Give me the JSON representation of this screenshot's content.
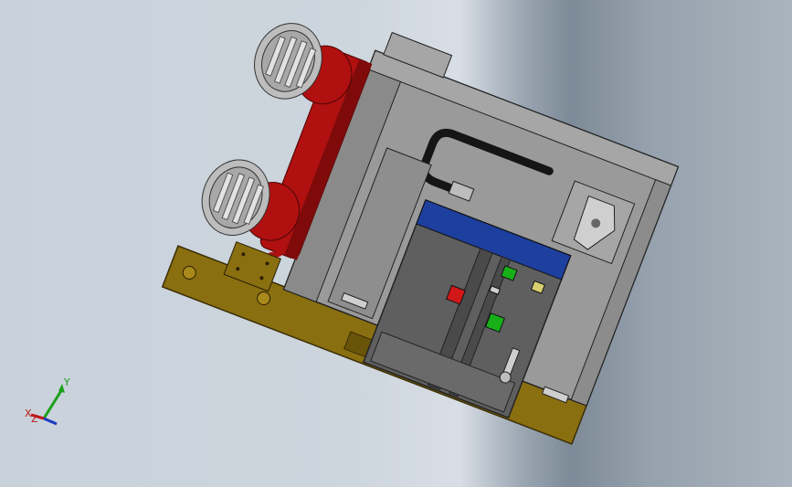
{
  "viewport": {
    "background_top": "#c9d2db",
    "background_band": "#7d8a97"
  },
  "model": {
    "colors": {
      "cabinet": "#9a9a9a",
      "cabinet_dark": "#7c7c7c",
      "insulator": "#b01010",
      "insulator_dark": "#7e0a0a",
      "base": "#8a6f10",
      "base_dark": "#6a540a",
      "blue_band": "#1d3f9e",
      "panel": "#5f5f5f",
      "panel_dark": "#4a4a4a",
      "indicator_red": "#d01818",
      "indicator_green": "#18b018",
      "indicator_yellow": "#d8d070",
      "handle": "#151515",
      "contact": "#bdbdbd"
    }
  },
  "triad": {
    "y_label": "Y",
    "x_label": "X",
    "z_label": "Z",
    "y_color": "#1aa01a",
    "x_color": "#c01818",
    "z_color": "#1a3ac0"
  }
}
